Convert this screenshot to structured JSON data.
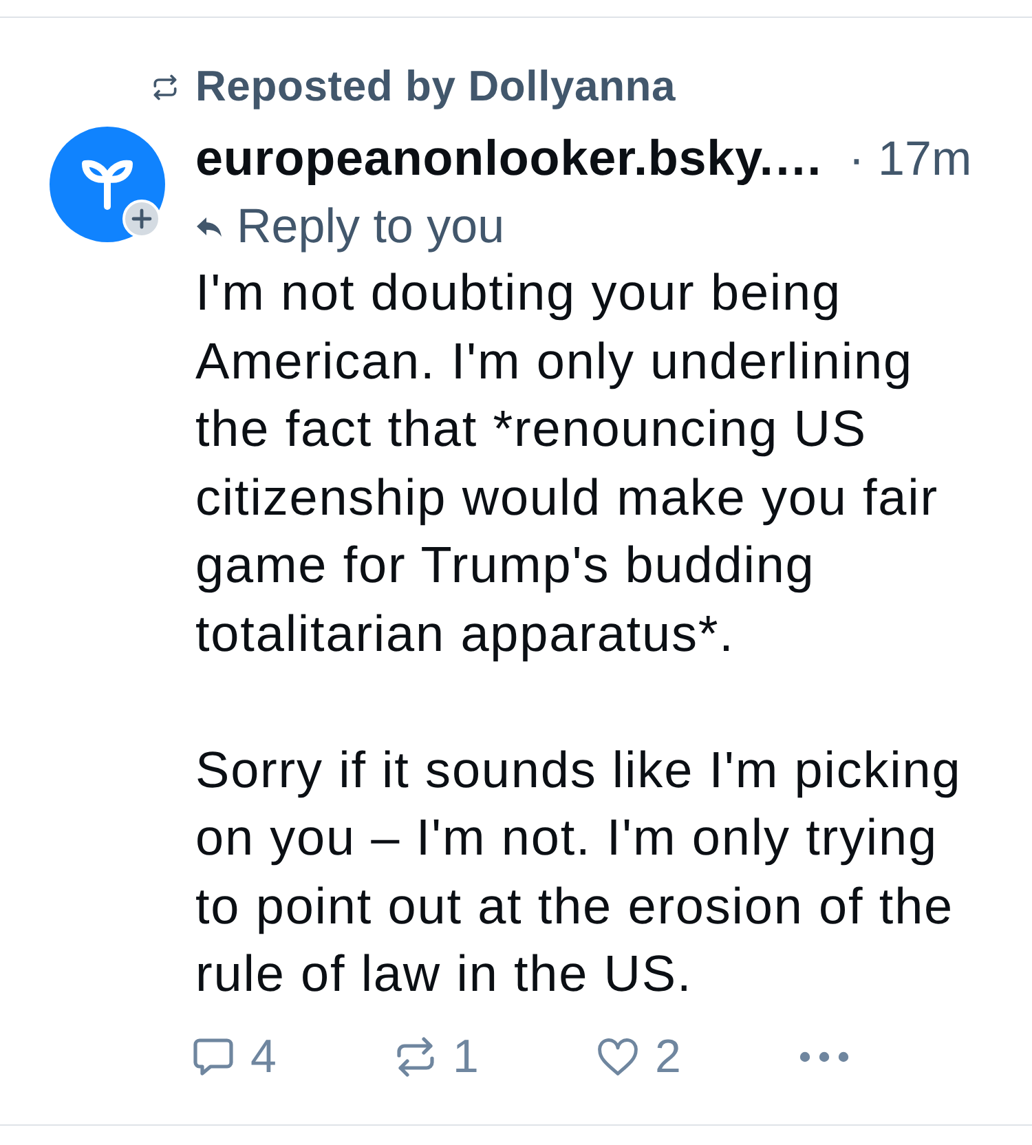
{
  "repost": {
    "label": "Reposted by Dollyanna"
  },
  "post": {
    "author": "europeanonlooker.bsky.…",
    "time": "· 17m",
    "reply_context": "Reply to you",
    "paragraphs": [
      "I'm not doubting your being American. I'm only underlining the fact that *renouncing US citizenship would make you fair game for Trump's budding totalitarian apparatus*.",
      "Sorry if it sounds like I'm picking on you – I'm not. I'm only trying to point out at the erosion of the rule of law in the US."
    ]
  },
  "actions": [
    {
      "kind": "reply",
      "count": "4"
    },
    {
      "kind": "repost",
      "count": "1"
    },
    {
      "kind": "like",
      "count": "2"
    },
    {
      "kind": "more"
    }
  ]
}
